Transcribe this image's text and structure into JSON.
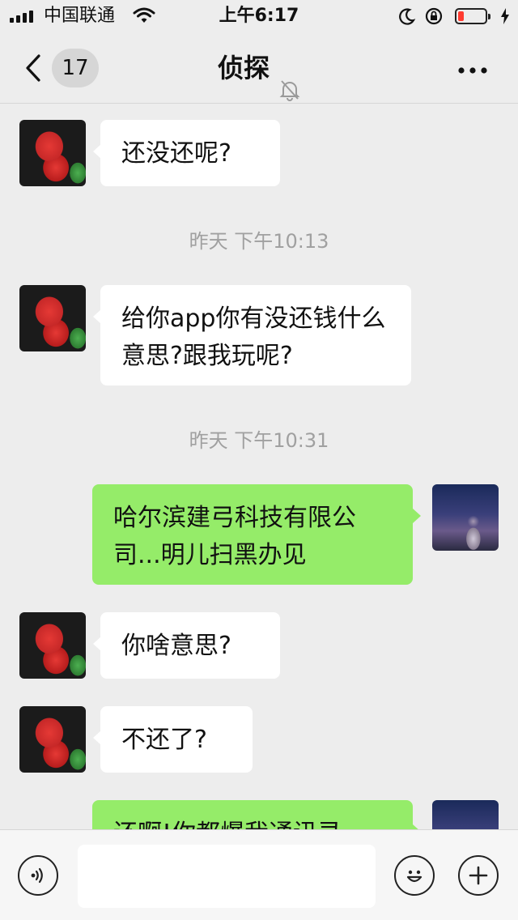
{
  "status_bar": {
    "carrier": "中国联通",
    "time": "上午6:17"
  },
  "nav": {
    "unread_count": "17",
    "title": "侦探"
  },
  "messages": [
    {
      "type": "in",
      "text": "还没还呢?"
    },
    {
      "type": "time",
      "text": "昨天 下午10:13"
    },
    {
      "type": "in",
      "text": "给你app你有没还钱什么意思?跟我玩呢?"
    },
    {
      "type": "time",
      "text": "昨天 下午10:31"
    },
    {
      "type": "out",
      "text": "哈尔滨建弓科技有限公司...明儿扫黑办见"
    },
    {
      "type": "in",
      "text": "你啥意思?"
    },
    {
      "type": "in",
      "text": "不还了?"
    },
    {
      "type": "out",
      "text": "还啊!你都爆我通讯录"
    }
  ],
  "colors": {
    "background": "#ededed",
    "incoming_bubble": "#ffffff",
    "outgoing_bubble": "#95ec69",
    "battery_low": "#ff3b30"
  },
  "icons": {
    "back": "chevron-left-icon",
    "mute": "bell-slash-icon",
    "more": "more-dots-icon",
    "voice": "voice-icon",
    "emoji": "emoji-icon",
    "add": "plus-icon"
  }
}
